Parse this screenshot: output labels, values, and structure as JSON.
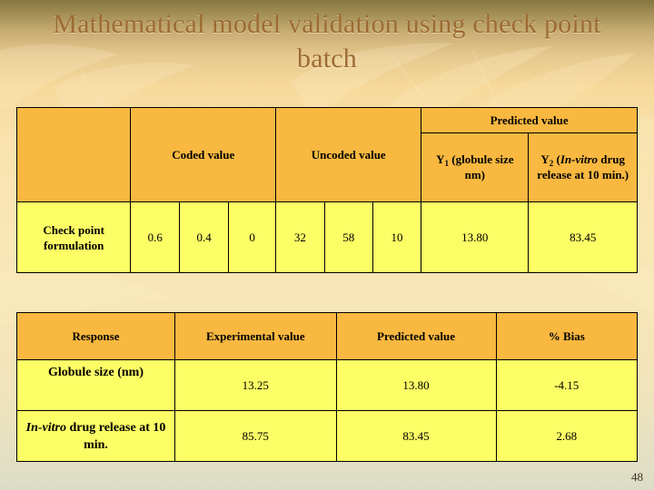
{
  "slide": {
    "title": "Mathematical model validation using check point batch",
    "number": "48",
    "colors": {
      "header_fill": "#F9B840",
      "body_fill": "#FDFD66",
      "title_text": "#9C6B33",
      "border": "#000000"
    }
  },
  "table1": {
    "headers": {
      "blank": "",
      "coded_value": "Coded value",
      "uncoded_value": "Uncoded value",
      "predicted_value": "Predicted value",
      "y1_prefix": "Y",
      "y1_sub": "1",
      "y1_rest": " (globule size nm)",
      "y2_prefix": "Y",
      "y2_sub": "2",
      "y2_open": " (",
      "y2_italic": "In-vitro",
      "y2_rest": " drug release at 10 min.)"
    },
    "row": {
      "label": "Check point formulation",
      "coded": [
        "0.6",
        "0.4",
        "0"
      ],
      "uncoded": [
        "32",
        "58",
        "10"
      ],
      "y1": "13.80",
      "y2": "83.45"
    }
  },
  "table2": {
    "headers": [
      "Response",
      "Experimental value",
      "Predicted value",
      "% Bias"
    ],
    "rows": [
      {
        "response": "Globule size (nm)",
        "response_italic": "",
        "response_rest": "",
        "experimental": "13.25",
        "predicted": "13.80",
        "bias": "-4.15"
      },
      {
        "response": "",
        "response_italic": "In-vitro",
        "response_rest": " drug release at 10 min.",
        "experimental": "85.75",
        "predicted": "83.45",
        "bias": "2.68"
      }
    ]
  }
}
